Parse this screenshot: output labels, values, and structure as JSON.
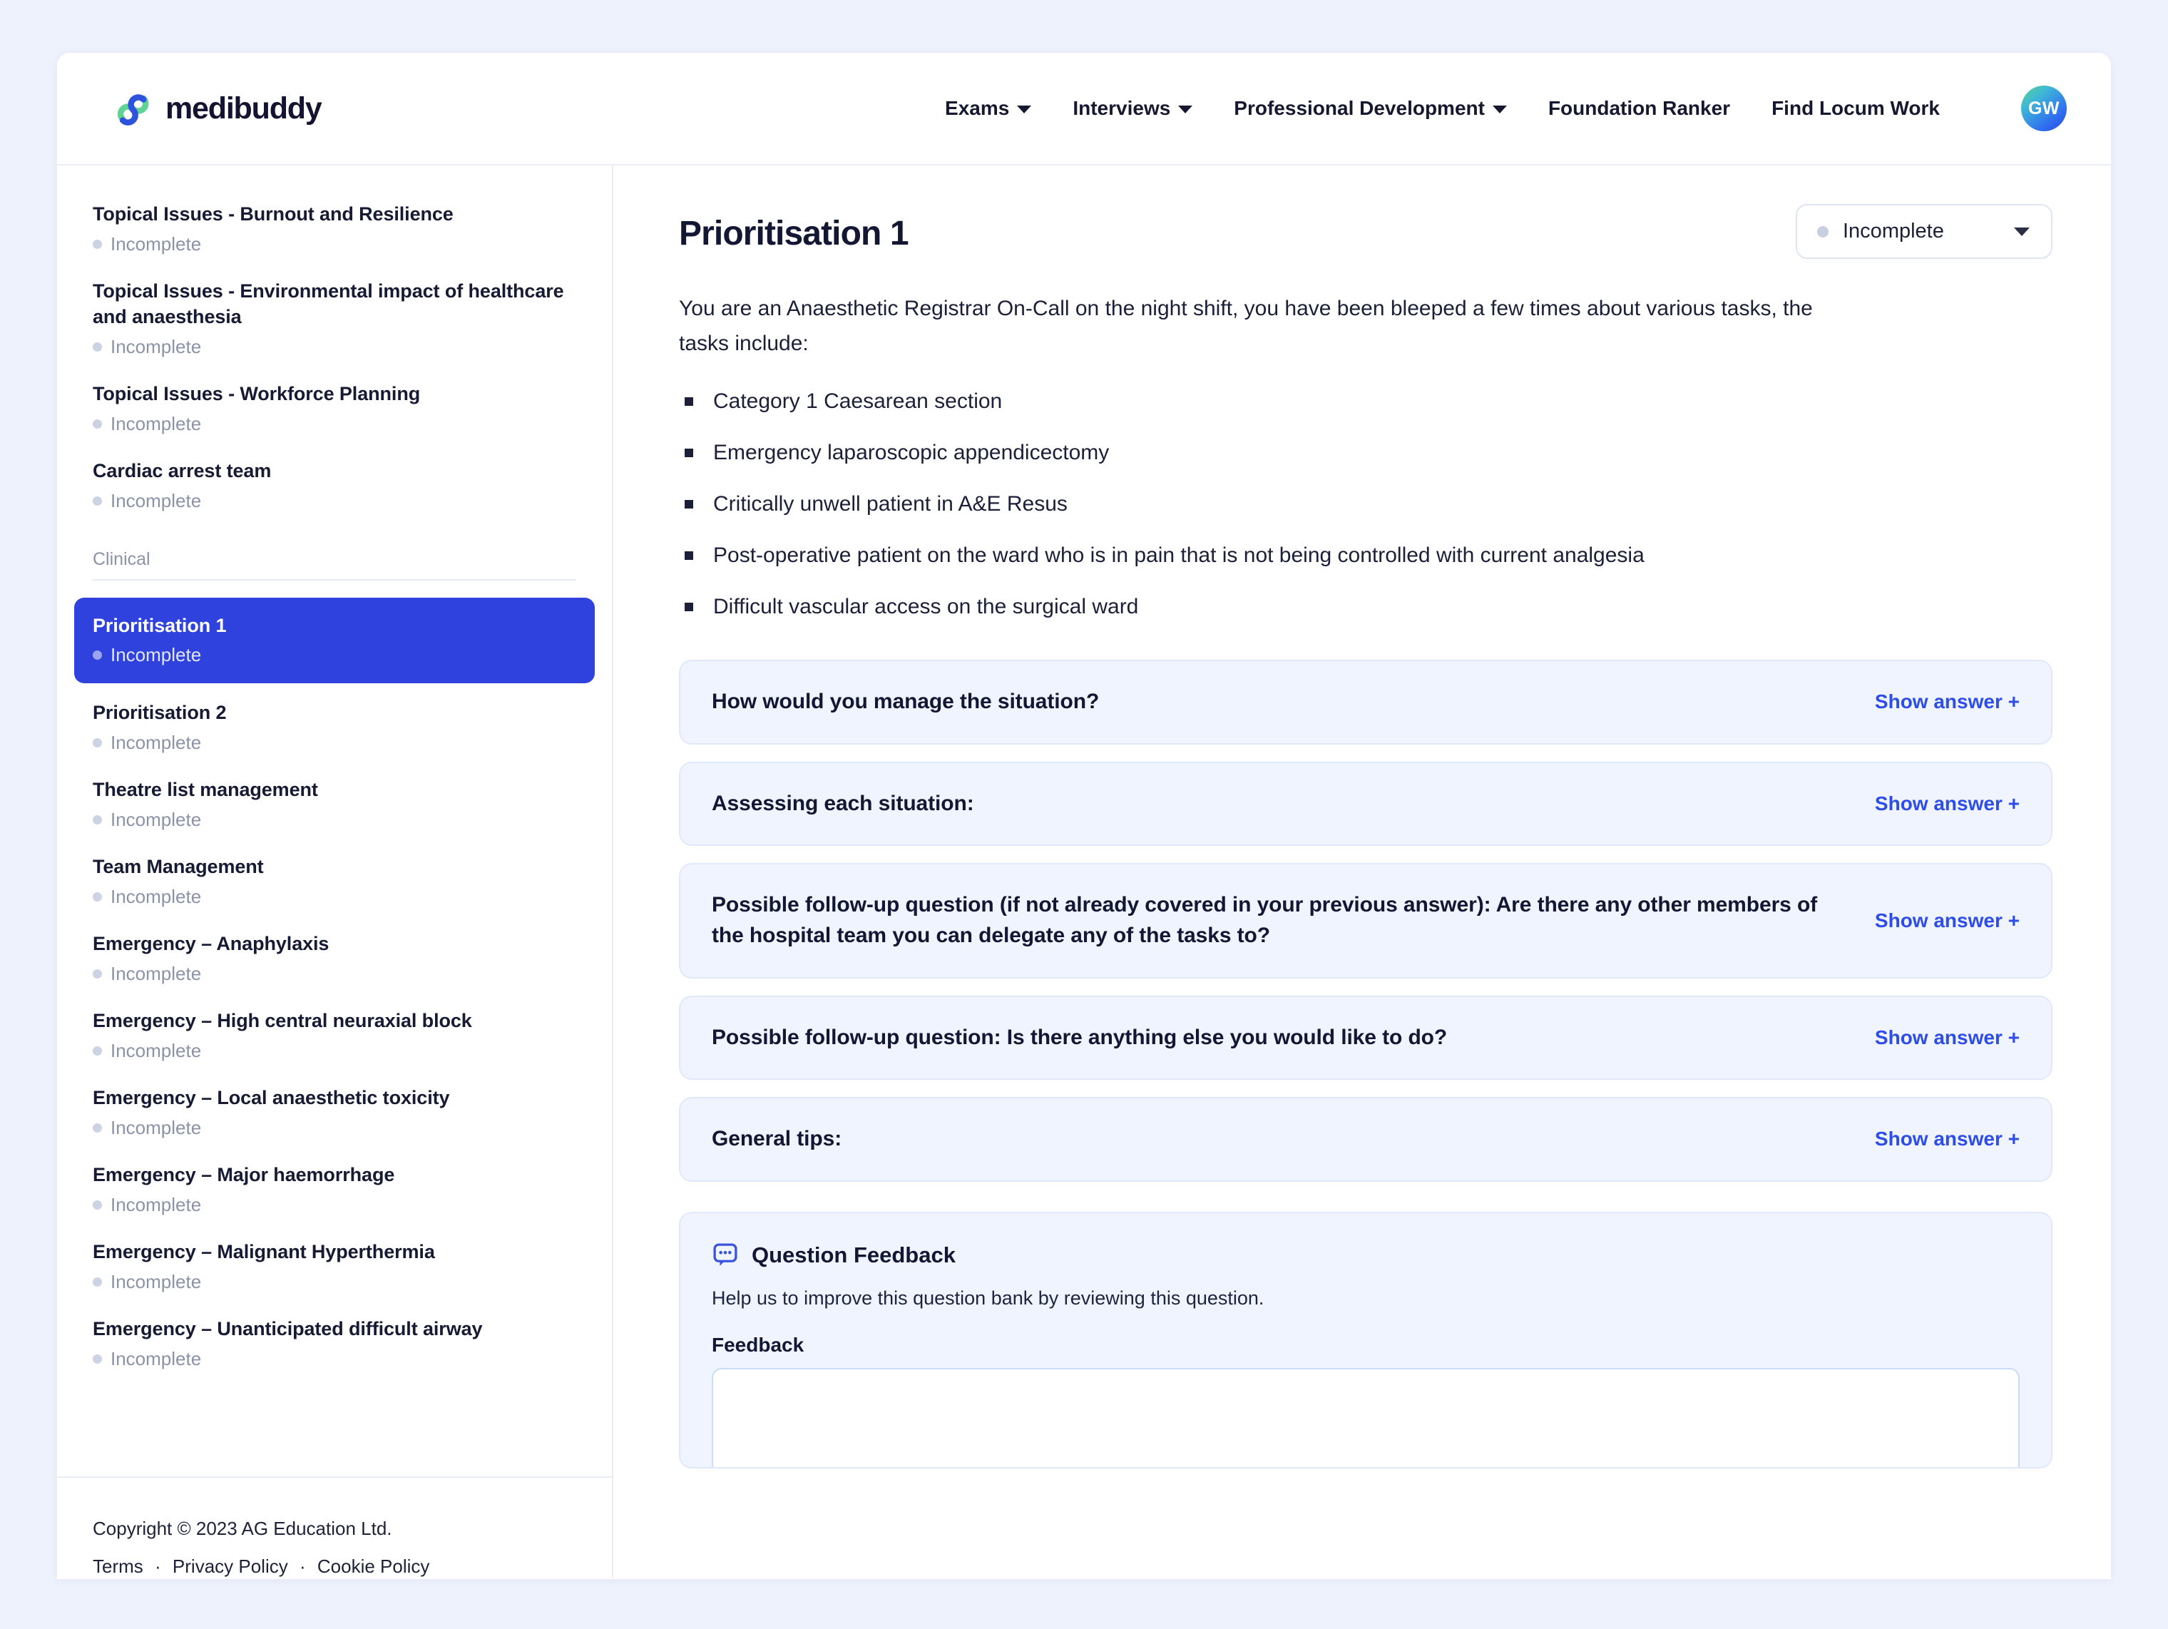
{
  "brand": {
    "name": "medibuddy",
    "logo_icon": "medibuddy-loop-logo"
  },
  "nav": {
    "items": [
      {
        "label": "Exams",
        "has_caret": true
      },
      {
        "label": "Interviews",
        "has_caret": true
      },
      {
        "label": "Professional Development",
        "has_caret": true
      },
      {
        "label": "Foundation Ranker",
        "has_caret": false
      },
      {
        "label": "Find Locum Work",
        "has_caret": false
      }
    ],
    "avatar_initials": "GW"
  },
  "sidebar": {
    "items": [
      {
        "title": "Topical Issues - Burnout and Resilience",
        "status": "Incomplete",
        "active": false
      },
      {
        "title": "Topical Issues - Environmental impact of healthcare and anaesthesia",
        "status": "Incomplete",
        "active": false
      },
      {
        "title": "Topical Issues - Workforce Planning",
        "status": "Incomplete",
        "active": false
      },
      {
        "title": "Cardiac arrest team",
        "status": "Incomplete",
        "active": false
      }
    ],
    "section_label": "Clinical",
    "clinical_items": [
      {
        "title": "Prioritisation 1",
        "status": "Incomplete",
        "active": true
      },
      {
        "title": "Prioritisation 2",
        "status": "Incomplete",
        "active": false
      },
      {
        "title": "Theatre list management",
        "status": "Incomplete",
        "active": false
      },
      {
        "title": "Team Management",
        "status": "Incomplete",
        "active": false
      },
      {
        "title": "Emergency – Anaphylaxis",
        "status": "Incomplete",
        "active": false
      },
      {
        "title": "Emergency – High central neuraxial block",
        "status": "Incomplete",
        "active": false
      },
      {
        "title": "Emergency – Local anaesthetic toxicity",
        "status": "Incomplete",
        "active": false
      },
      {
        "title": "Emergency – Major haemorrhage",
        "status": "Incomplete",
        "active": false
      },
      {
        "title": "Emergency – Malignant Hyperthermia",
        "status": "Incomplete",
        "active": false
      },
      {
        "title": "Emergency – Unanticipated difficult airway",
        "status": "Incomplete",
        "active": false
      }
    ],
    "footer": {
      "copyright": "Copyright © 2023 AG Education Ltd.",
      "links": [
        "Terms",
        "Privacy Policy",
        "Cookie Policy"
      ],
      "separator": "·"
    }
  },
  "main": {
    "title": "Prioritisation 1",
    "status_dropdown": {
      "value": "Incomplete",
      "caret_icon": "chevron-down-icon"
    },
    "intro": "You are an Anaesthetic Registrar On-Call on the night shift, you have been bleeped a few times about various tasks, the tasks include:",
    "tasks": [
      "Category 1 Caesarean section",
      "Emergency laparoscopic appendicectomy",
      "Critically unwell patient in A&E Resus",
      "Post-operative patient on the ward who is in pain that is not being controlled with current analgesia",
      "Difficult vascular access on the surgical ward"
    ],
    "questions": [
      {
        "text": "How would you manage the situation?",
        "action": "Show answer +"
      },
      {
        "text": "Assessing each situation:",
        "action": "Show answer +"
      },
      {
        "text": "Possible follow-up question (if not already covered in your previous answer): Are there any other members of the hospital team you can delegate any of the tasks to?",
        "action": "Show answer +"
      },
      {
        "text": "Possible follow-up question: Is there anything else you would like to do?",
        "action": "Show answer +"
      },
      {
        "text": "General tips:",
        "action": "Show answer +"
      }
    ],
    "feedback": {
      "icon": "chat-bubble-icon",
      "title": "Question Feedback",
      "subtitle": "Help us to improve this question bank by reviewing this question.",
      "field_label": "Feedback",
      "textarea_value": "",
      "textarea_placeholder": ""
    }
  },
  "colors": {
    "page_bg": "#edf2fd",
    "accent_blue": "#2f42de",
    "link_blue": "#2d4ce8",
    "card_bg": "#eff4fe",
    "logo_blue": "#2f52dd",
    "logo_green": "#5fd394",
    "muted": "#8b93a7"
  }
}
